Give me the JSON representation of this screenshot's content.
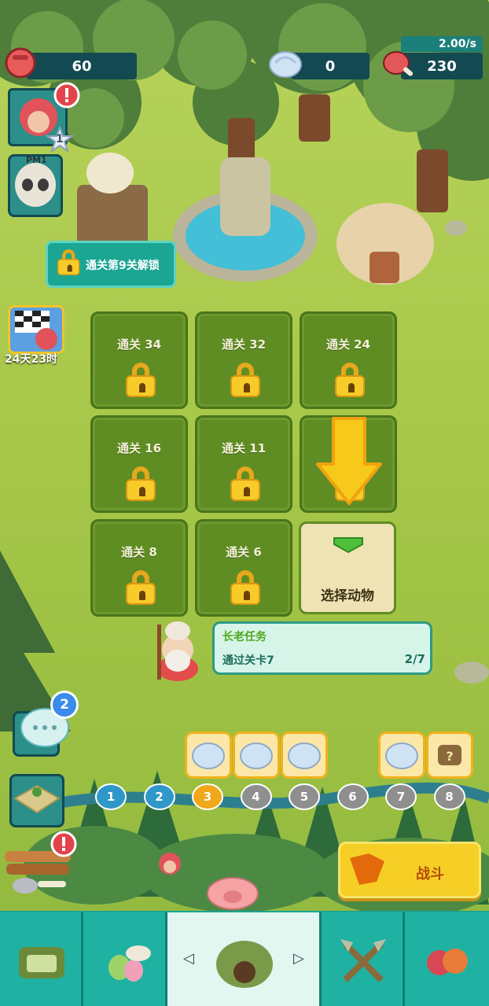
{
  "resources": {
    "power": "60",
    "shells": "0",
    "meat": "230",
    "rate": "2.00/s"
  },
  "player": {
    "level": "1",
    "pm_tag": "PM1"
  },
  "event": {
    "timer": "24天23时"
  },
  "unlock_banner": {
    "label": "通关第9关解锁"
  },
  "levels": [
    {
      "label": "通关 34"
    },
    {
      "label": "通关 32"
    },
    {
      "label": "通关 24"
    },
    {
      "label": "通关 16"
    },
    {
      "label": "通关 11"
    },
    {
      "label": "通关 8"
    },
    {
      "label": "通关 6"
    }
  ],
  "select_animal": {
    "label": "选择动物"
  },
  "quest": {
    "title": "长老任务",
    "task": "通过关卡7",
    "progress": "2/7"
  },
  "chat": {
    "badge": "2"
  },
  "stage_nodes": [
    "1",
    "2",
    "3",
    "4",
    "5",
    "6",
    "7",
    "8"
  ],
  "current_stage": "3",
  "fight_button": {
    "label": "战斗"
  },
  "tabs": [
    {
      "icon": "camp-icon"
    },
    {
      "icon": "fossil-egg-icon"
    },
    {
      "icon": "cave-icon"
    },
    {
      "icon": "crossed-weapons-icon"
    },
    {
      "icon": "creatures-icon"
    }
  ],
  "colors": {
    "accent_teal": "#1aa395",
    "active_tab": "#e3f6ef",
    "node_done": "#2f98c9",
    "node_current": "#f0a81a",
    "node_locked": "#8f8f8f",
    "fight_yellow": "#f6cf26"
  }
}
